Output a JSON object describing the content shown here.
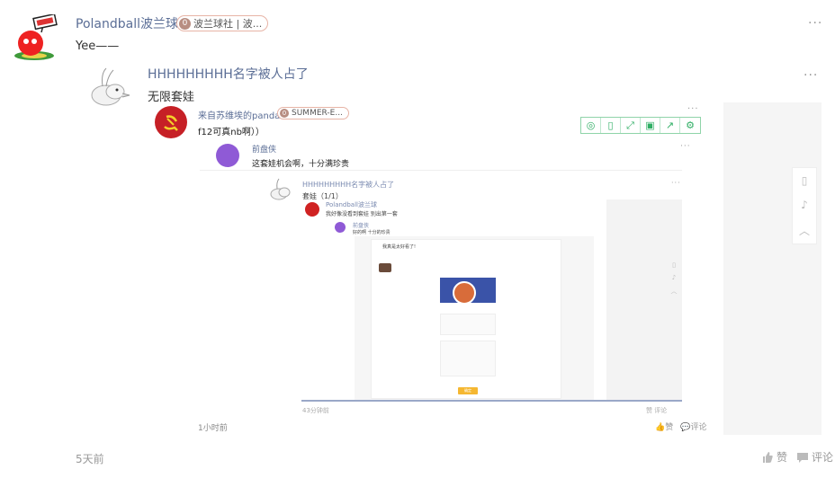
{
  "comment": {
    "username": "Polandball波兰球",
    "badge_level": "0",
    "badge_text": "波兰球社 | 波...",
    "text": "Yee——",
    "time": "5天前",
    "like_label": "赞",
    "comment_label": "评论",
    "more": "..."
  },
  "reply": {
    "username": "HHHHHHHHH名字被人占了",
    "text": "无限套娃",
    "more": "..."
  },
  "shot": {
    "user1": {
      "username": "来自苏维埃的panda",
      "badge_level": "0",
      "badge_text": "SUMMER-E...",
      "text": "f12可真nb啊））",
      "time": "1小时前",
      "like_label": "赞",
      "comment_label": "评论"
    },
    "user2": {
      "username": "前盘侠",
      "text": "这套娃机会啊，十分满珍贵"
    },
    "user3": {
      "username": "HHHHHHHHH名字被人占了",
      "text": "套娃（1/1）",
      "time": "43分钟前",
      "like_label": "赞",
      "comment_label": "评论"
    },
    "user4": {
      "username": "Polandball波兰球",
      "text": "我好像没看到套娃 别出第一套"
    },
    "user5": {
      "username": "前盘侠",
      "text": "好的啊 十分的珍贵"
    },
    "card_title": "我真是太好看了!",
    "card_button": "确定"
  },
  "colors": {
    "link": "#5b6e96",
    "toolbar": "#2fae64",
    "badge_border": "#e7b4a6"
  }
}
